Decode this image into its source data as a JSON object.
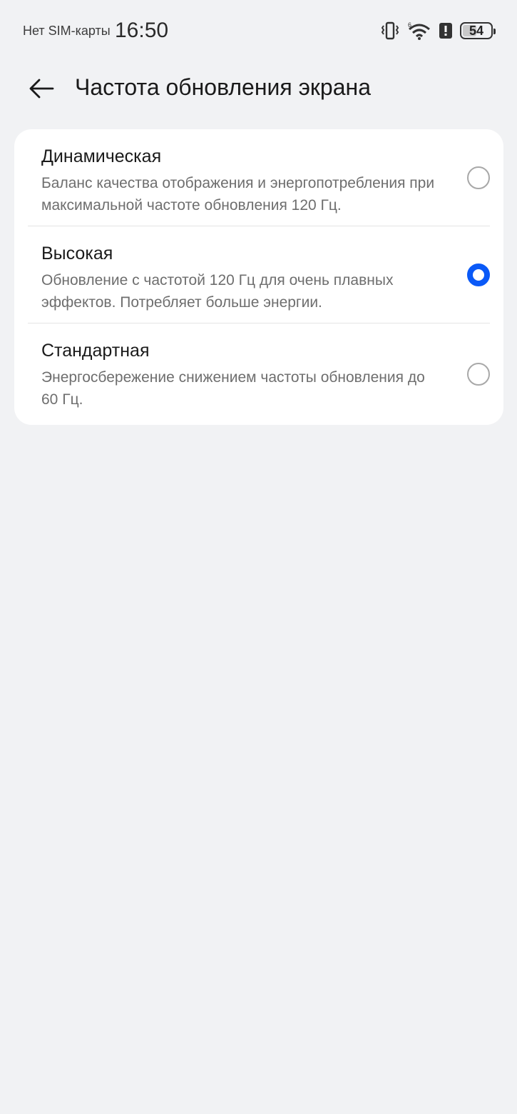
{
  "status_bar": {
    "carrier": "Нет SIM-карты",
    "time": "16:50",
    "battery_level": "54",
    "icons": [
      "vibrate-icon",
      "wifi-icon",
      "alert-icon",
      "battery-icon"
    ]
  },
  "app_bar": {
    "title": "Частота обновления экрана"
  },
  "options": [
    {
      "title": "Динамическая",
      "description": "Баланс качества отображения и энергопотребления при максимальной частоте обновления 120 Гц.",
      "selected": false
    },
    {
      "title": "Высокая",
      "description": "Обновление с частотой 120 Гц для очень плавных эффектов. Потребляет больше энергии.",
      "selected": true
    },
    {
      "title": "Стандартная",
      "description": "Энергосбережение снижением частоты обновления до 60 Гц.",
      "selected": false
    }
  ],
  "colors": {
    "accent": "#0a59f7",
    "background": "#f1f2f4",
    "card": "#ffffff",
    "secondary_text": "#6e6e6e"
  }
}
